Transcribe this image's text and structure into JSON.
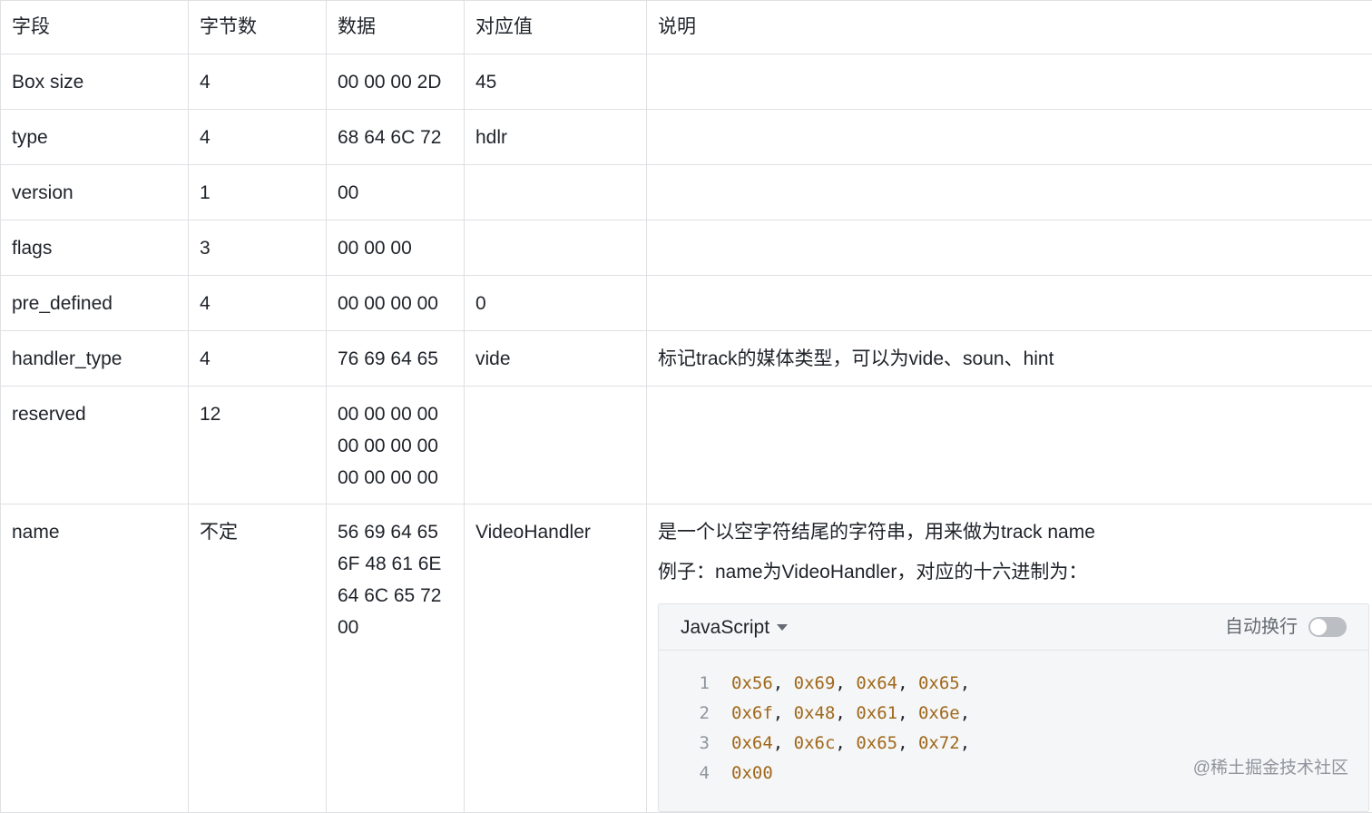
{
  "table": {
    "headers": [
      "字段",
      "字节数",
      "数据",
      "对应值",
      "说明"
    ],
    "rows": [
      {
        "field": "Box size",
        "bytes": "4",
        "data": [
          "00 00 00 2D"
        ],
        "value": "45",
        "desc": ""
      },
      {
        "field": "type",
        "bytes": "4",
        "data": [
          "68 64 6C 72"
        ],
        "value": "hdlr",
        "desc": ""
      },
      {
        "field": "version",
        "bytes": "1",
        "data": [
          "00"
        ],
        "value": "",
        "desc": ""
      },
      {
        "field": "flags",
        "bytes": "3",
        "data": [
          "00 00 00"
        ],
        "value": "",
        "desc": ""
      },
      {
        "field": "pre_defined",
        "bytes": "4",
        "data": [
          "00 00 00 00"
        ],
        "value": "0",
        "desc": ""
      },
      {
        "field": "handler_type",
        "bytes": "4",
        "data": [
          "76 69 64 65"
        ],
        "value": "vide",
        "desc": "标记track的媒体类型，可以为vide、soun、hint"
      },
      {
        "field": "reserved",
        "bytes": "12",
        "data": [
          "00 00 00 00",
          "00 00 00 00",
          "00 00 00 00"
        ],
        "value": "",
        "desc": ""
      },
      {
        "field": "name",
        "bytes": "不定",
        "data": [
          "56 69 64 65",
          "6F 48 61 6E",
          "64 6C 65 72",
          "00"
        ],
        "value": "VideoHandler",
        "desc": "是一个以空字符结尾的字符串，用来做为track name"
      }
    ],
    "name_desc_line2": "例子：name为VideoHandler，对应的十六进制为："
  },
  "code_block": {
    "language": "JavaScript",
    "wrap_label": "自动换行",
    "wrap_enabled": false,
    "lines": [
      {
        "no": "1",
        "tokens": [
          "0x56",
          "0x69",
          "0x64",
          "0x65"
        ],
        "trailing": ","
      },
      {
        "no": "2",
        "tokens": [
          "0x6f",
          "0x48",
          "0x61",
          "0x6e"
        ],
        "trailing": ","
      },
      {
        "no": "3",
        "tokens": [
          "0x64",
          "0x6c",
          "0x65",
          "0x72"
        ],
        "trailing": ","
      },
      {
        "no": "4",
        "tokens": [
          "0x00"
        ],
        "trailing": ""
      }
    ]
  },
  "watermark": "@稀土掘金技术社区",
  "colors": {
    "border": "#dee0e3",
    "code_number": "#a0681b",
    "code_bg": "#f5f6f7"
  }
}
